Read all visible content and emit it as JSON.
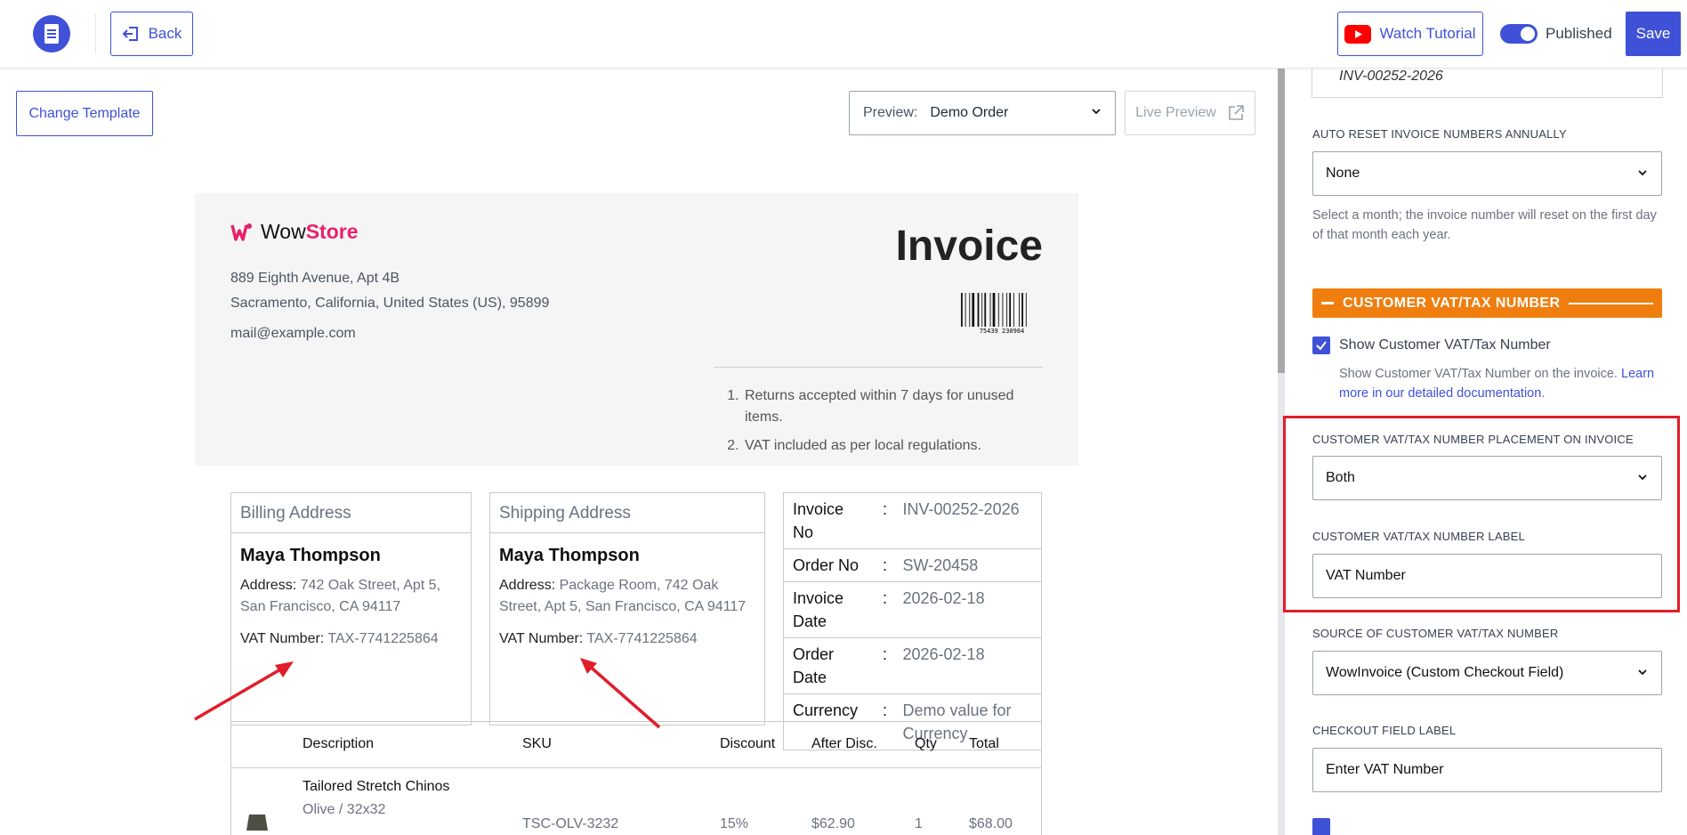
{
  "topbar": {
    "back_label": "Back",
    "tutorial_label": "Watch Tutorial",
    "published_label": "Published",
    "published_on": true,
    "save_label": "Save"
  },
  "toolbar": {
    "change_template_label": "Change Template",
    "preview_label": "Preview:",
    "preview_value": "Demo Order",
    "live_preview_label": "Live Preview"
  },
  "invoice": {
    "brand_prefix": "Wow",
    "brand_suffix": "Store",
    "address_line1": "889 Eighth Avenue, Apt 4B",
    "address_line2": "Sacramento, California, United States (US), 95899",
    "email": "mail@example.com",
    "title": "Invoice",
    "barcode_text": "75439 230964",
    "notes": [
      "Returns accepted within 7 days for unused items.",
      "VAT included as per local regulations."
    ],
    "billing": {
      "heading": "Billing Address",
      "name": "Maya Thompson",
      "address_key": "Address:",
      "address_value": "742 Oak Street, Apt 5, San Francisco, CA 94117",
      "vat_key": "VAT Number:",
      "vat_value": "TAX-7741225864"
    },
    "shipping": {
      "heading": "Shipping Address",
      "name": "Maya Thompson",
      "address_key": "Address:",
      "address_value": "Package Room, 742 Oak Street, Apt 5, San Francisco, CA 94117",
      "vat_key": "VAT Number:",
      "vat_value": "TAX-7741225864"
    },
    "meta": [
      {
        "key": "Invoice No",
        "value": "INV-00252-2026"
      },
      {
        "key": "Order No",
        "value": "SW-20458"
      },
      {
        "key": "Invoice Date",
        "value": "2026-02-18"
      },
      {
        "key": "Order Date",
        "value": "2026-02-18"
      },
      {
        "key": "Currency",
        "value": "Demo value for Currency"
      }
    ],
    "items_headers": [
      "Description",
      "SKU",
      "Discount",
      "After Disc.",
      "Qty",
      "Total"
    ],
    "items": [
      {
        "name": "Tailored Stretch Chinos",
        "variant": "Olive / 32x32",
        "sku": "TSC-OLV-3232",
        "discount": "15%",
        "after": "$62.90",
        "qty": "1",
        "total": "$68.00"
      }
    ]
  },
  "sidebar": {
    "invoice_number_preview": "INV-00252-2026",
    "auto_reset_label": "AUTO RESET INVOICE NUMBERS ANNUALLY",
    "auto_reset_value": "None",
    "auto_reset_help": "Select a month; the invoice number will reset on the first day of that month each year.",
    "section_title": "CUSTOMER VAT/TAX NUMBER",
    "show_vat_label": "Show Customer VAT/Tax Number",
    "show_vat_checked": true,
    "show_vat_help": "Show Customer VAT/Tax Number on the invoice.",
    "show_vat_link": "Learn more in our detailed documentation",
    "placement_label": "CUSTOMER VAT/TAX NUMBER PLACEMENT ON INVOICE",
    "placement_value": "Both",
    "vat_label_label": "CUSTOMER VAT/TAX NUMBER LABEL",
    "vat_label_value": "VAT Number",
    "source_label": "SOURCE OF CUSTOMER VAT/TAX NUMBER",
    "source_value": "WowInvoice (Custom Checkout Field)",
    "checkout_label": "CHECKOUT FIELD LABEL",
    "checkout_placeholder": "Enter VAT Number"
  },
  "colors": {
    "accent": "#3f51d6",
    "section": "#f07e0e",
    "highlight": "#e11d2b",
    "brand_pink": "#e8216b"
  }
}
